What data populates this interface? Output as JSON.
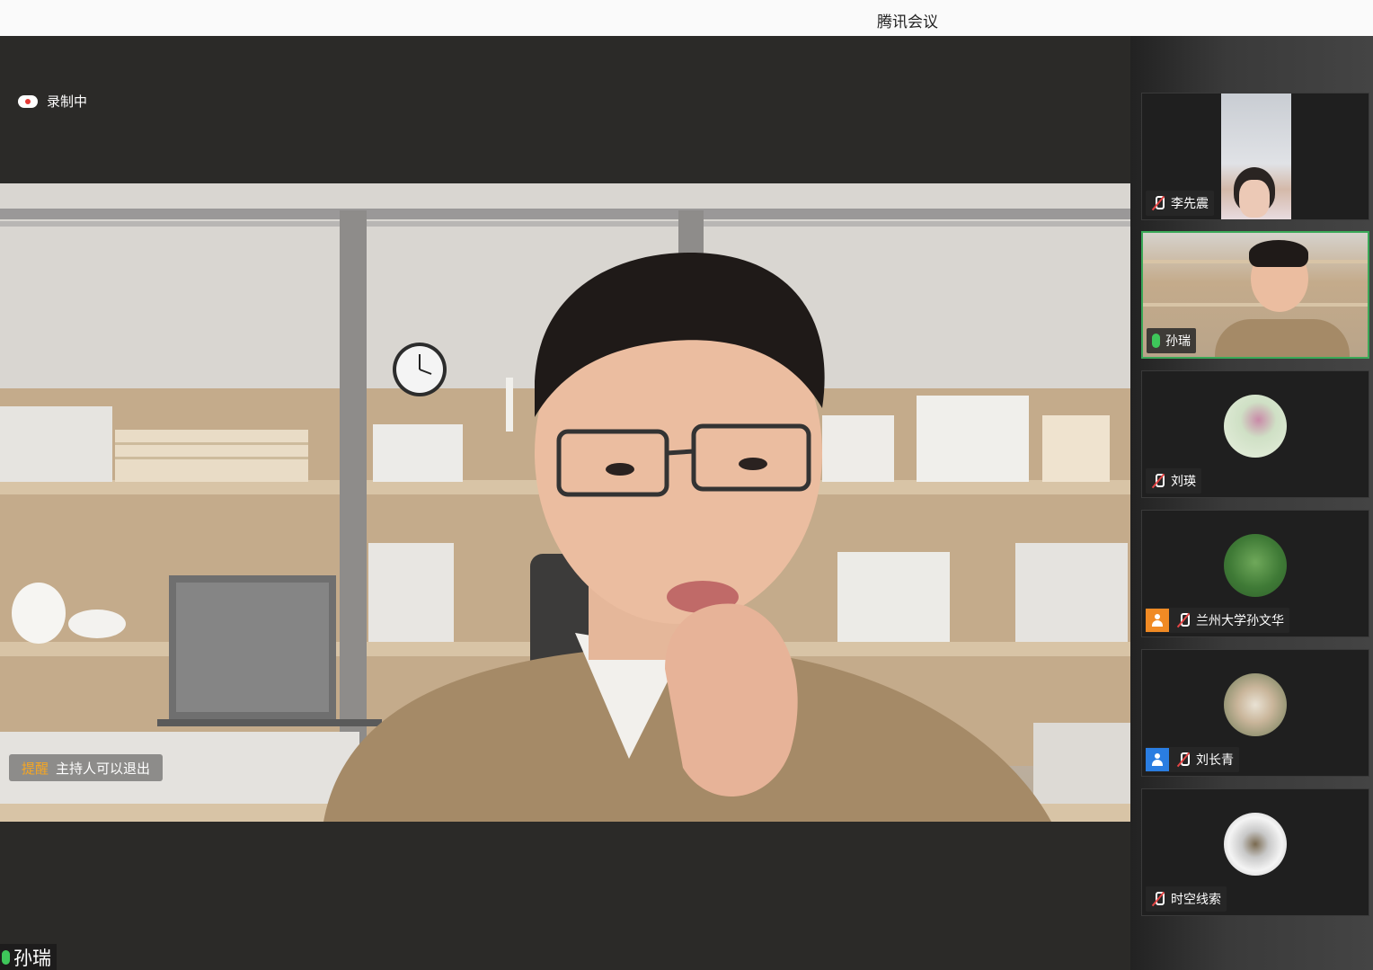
{
  "window": {
    "title": "腾讯会议"
  },
  "recording": {
    "label": "录制中"
  },
  "toast": {
    "tag": "提醒",
    "text": "主持人可以退出"
  },
  "self": {
    "name": "孙瑞"
  },
  "participants": [
    {
      "name": "李先震",
      "mic": "muted",
      "view": "video"
    },
    {
      "name": "孙瑞",
      "mic": "on",
      "view": "video",
      "active": true
    },
    {
      "name": "刘瑛",
      "mic": "muted",
      "view": "avatar"
    },
    {
      "name": "兰州大学孙文华",
      "mic": "muted",
      "view": "avatar",
      "badge": "orange"
    },
    {
      "name": "刘长青",
      "mic": "muted",
      "view": "avatar",
      "badge": "blue"
    },
    {
      "name": "时空线索",
      "mic": "muted",
      "view": "avatar"
    }
  ],
  "colors": {
    "speaking": "#3aa857",
    "muted": "#e54545",
    "orange_badge": "#f08a24",
    "blue_badge": "#2a7de1"
  }
}
